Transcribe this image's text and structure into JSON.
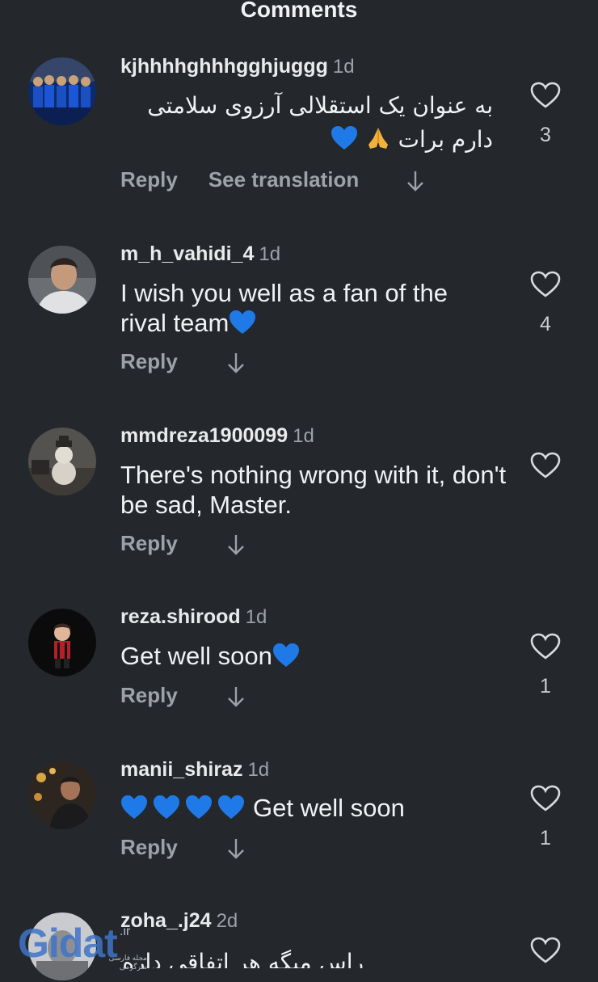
{
  "header": {
    "title": "Comments"
  },
  "comments": [
    {
      "username": "kjhhhhghhhgghjuggg",
      "time": "1d",
      "text_line1": "به عنوان یک استقلالی آرزوی سلامتی",
      "text_line2": "دارم برات",
      "likes": "3",
      "reply": "Reply",
      "see_translation": "See translation"
    },
    {
      "username": "m_h_vahidi_4",
      "time": "1d",
      "text": "I wish you well as a fan of the rival team",
      "likes": "4",
      "reply": "Reply"
    },
    {
      "username": "mmdreza1900099",
      "time": "1d",
      "text": "There's nothing wrong with it, don't be sad, Master.",
      "likes": "",
      "reply": "Reply"
    },
    {
      "username": "reza.shirood",
      "time": "1d",
      "text": "Get well soon",
      "likes": "1",
      "reply": "Reply"
    },
    {
      "username": "manii_shiraz",
      "time": "1d",
      "text": "Get well soon",
      "likes": "1",
      "reply": "Reply"
    },
    {
      "username": "zoha_.j24",
      "time": "2d",
      "text": "راس میگه هر اتفاقی داره 🙏",
      "likes": ""
    }
  ],
  "watermark": {
    "brand": "Gidat",
    "tld": ".ir",
    "subtitle": "مجله فارسی سرگرمی"
  },
  "icons": {
    "like": "heart-outline-icon",
    "more_replies": "arrow-down-icon",
    "emoji_heart": "blue-heart-emoji",
    "emoji_hands": "folded-hands-emoji"
  },
  "colors": {
    "background": "#24272c",
    "primary_text": "#f1f2f4",
    "secondary_text": "#9da1a8",
    "emoji_heart": "#1f7ae8",
    "emoji_hands": "#f2b23a",
    "watermark": "#3f74c9"
  }
}
